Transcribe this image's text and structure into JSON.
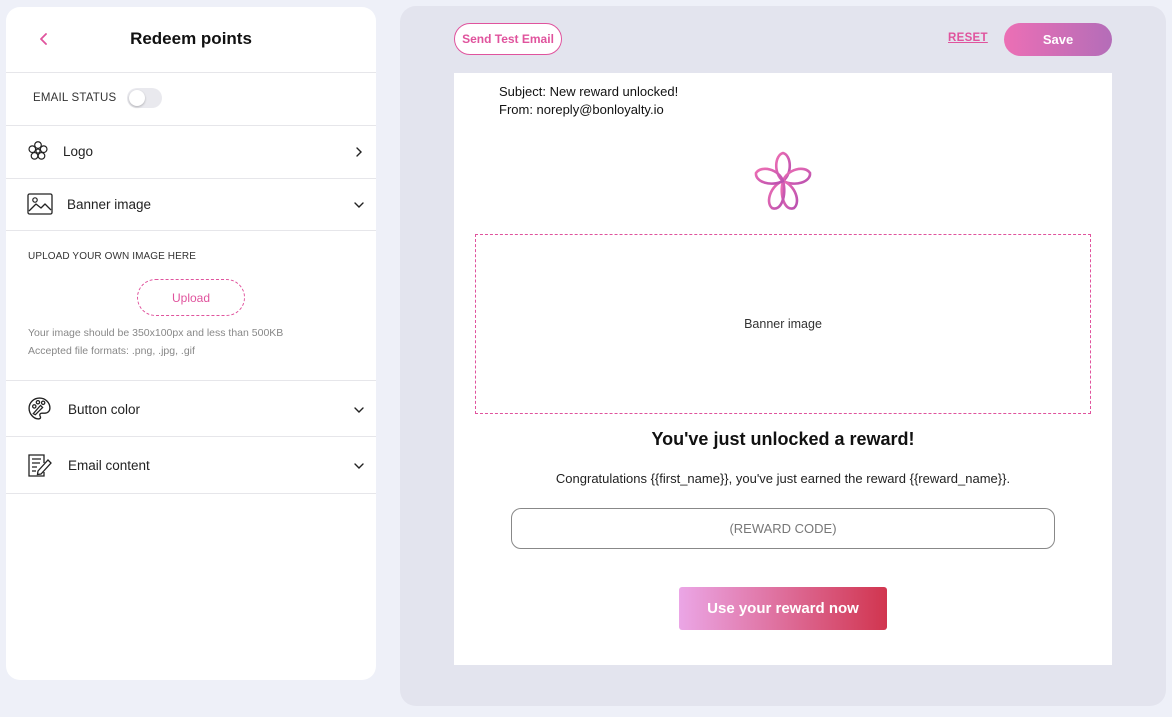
{
  "sidebar": {
    "title": "Redeem points",
    "email_status_label": "EMAIL STATUS",
    "email_status_on": false,
    "items": [
      {
        "label": "Logo",
        "icon": "flower-icon",
        "expanded": false
      },
      {
        "label": "Banner image",
        "icon": "image-icon",
        "expanded": true
      },
      {
        "label": "Button color",
        "icon": "palette-icon",
        "expanded": false
      },
      {
        "label": "Email content",
        "icon": "edit-document-icon",
        "expanded": false
      }
    ],
    "upload": {
      "title": "UPLOAD YOUR OWN IMAGE HERE",
      "button_label": "Upload",
      "hint_size": "Your image should be 350x100px and less than 500KB",
      "hint_formats": "Accepted file formats: .png, .jpg, .gif"
    }
  },
  "toolbar": {
    "test_email_label": "Send Test Email",
    "reset_label": "RESET",
    "save_label": "Save"
  },
  "email": {
    "subject": "Subject: New reward unlocked!",
    "from": "From: noreply@bonloyalty.io",
    "banner_placeholder": "Banner image",
    "headline": "You've just unlocked a reward!",
    "body": "Congratulations {{first_name}}, you've just earned the reward {{reward_name}}.",
    "reward_code": "(REWARD CODE)",
    "cta_label": "Use your reward now"
  },
  "colors": {
    "accent": "#e0539d",
    "save_gradient_start": "#ec6fb5",
    "save_gradient_end": "#b46db8",
    "cta_gradient_start": "#eba6e6",
    "cta_gradient_end": "#d1354f"
  }
}
